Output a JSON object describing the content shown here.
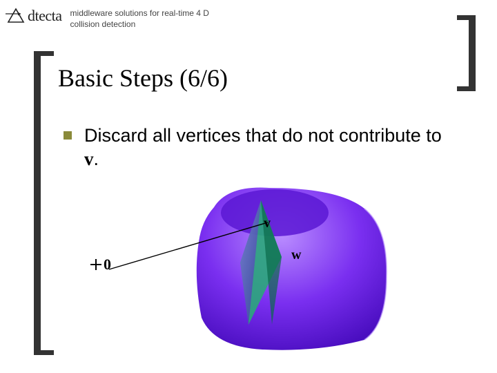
{
  "header": {
    "brand": "dtecta",
    "tagline": "middleware solutions for real-time 4 D collision detection"
  },
  "slide": {
    "title": "Basic Steps (6/6)",
    "bullet_prefix": "Discard all vertices that do not contribute to ",
    "bullet_var": "v",
    "bullet_suffix": "."
  },
  "figure": {
    "origin_label": "0",
    "label_v": "v",
    "label_w": "w"
  }
}
